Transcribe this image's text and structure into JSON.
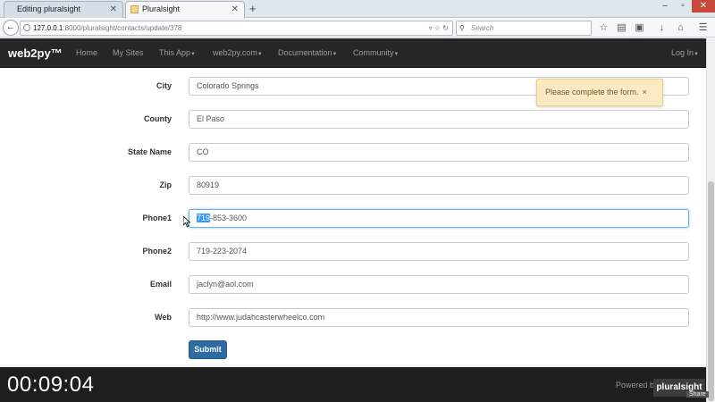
{
  "browser": {
    "tabs": [
      {
        "label": "Editing pluralsight",
        "active": false
      },
      {
        "label": "Pluralsight",
        "active": true
      }
    ],
    "url_host": "127.0.0.1",
    "url_rest": ":8000/pluralsight/contacts/update/378",
    "search_placeholder": "Search"
  },
  "app": {
    "brand": "web2py™",
    "nav": [
      "Home",
      "My Sites",
      "This App",
      "web2py.com",
      "Documentation",
      "Community"
    ],
    "login": "Log In"
  },
  "form": {
    "rows": [
      {
        "label": "City",
        "value": "Colorado Springs"
      },
      {
        "label": "County",
        "value": "El Paso"
      },
      {
        "label": "State Name",
        "value": "CO"
      },
      {
        "label": "Zip",
        "value": "80919"
      },
      {
        "label": "Phone1",
        "value_selected": "719",
        "value_rest": "-853-3600"
      },
      {
        "label": "Phone2",
        "value": "719-223-2074"
      },
      {
        "label": "Email",
        "value": "jaclyn@aol.com"
      },
      {
        "label": "Web",
        "value": "http://www.judahcasterwheelco.com"
      }
    ],
    "submit_label": "Submit"
  },
  "flash": {
    "message": "Please complete the form.",
    "close": "×"
  },
  "overlay": {
    "timer": "00:09:04",
    "powered": "Powered by",
    "logo": "pluralsight",
    "share": "Share"
  },
  "colors": {
    "navbar": "#262626",
    "submit": "#2d6ca2",
    "flash_bg": "#fbeac1",
    "focus": "#66afe9"
  }
}
